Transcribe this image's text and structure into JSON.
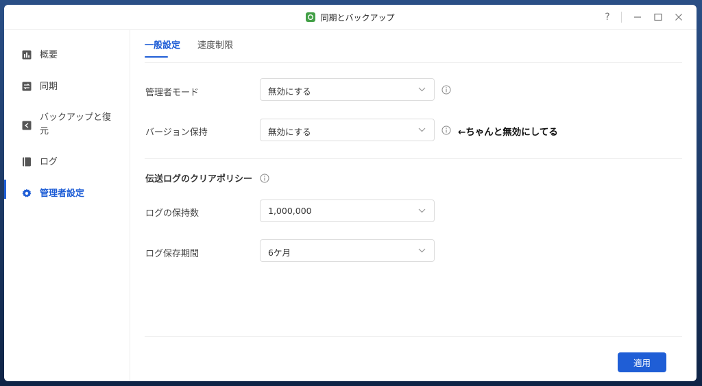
{
  "window": {
    "title": "同期とバックアップ",
    "help_label": "?"
  },
  "sidebar": {
    "items": [
      {
        "label": "概要",
        "icon": "overview-icon"
      },
      {
        "label": "同期",
        "icon": "sync-icon"
      },
      {
        "label": "バックアップと復元",
        "icon": "backup-restore-icon"
      },
      {
        "label": "ログ",
        "icon": "log-icon"
      },
      {
        "label": "管理者設定",
        "icon": "gear-icon",
        "active": true
      }
    ]
  },
  "tabs": [
    {
      "label": "一般設定",
      "active": true
    },
    {
      "label": "速度制限",
      "active": false
    }
  ],
  "settings": {
    "admin_mode": {
      "label": "管理者モード",
      "value": "無効にする"
    },
    "version_keep": {
      "label": "バージョン保持",
      "value": "無効にする",
      "annotation": "←ちゃんと無効にしてる"
    },
    "log_section_title": "伝送ログのクリアポリシー",
    "log_count": {
      "label": "ログの保持数",
      "value": "1,000,000"
    },
    "log_period": {
      "label": "ログ保存期間",
      "value": "6ケ月"
    }
  },
  "footer": {
    "apply_label": "適用"
  },
  "colors": {
    "accent": "#1f5ed6",
    "app_icon": "#43a047"
  }
}
